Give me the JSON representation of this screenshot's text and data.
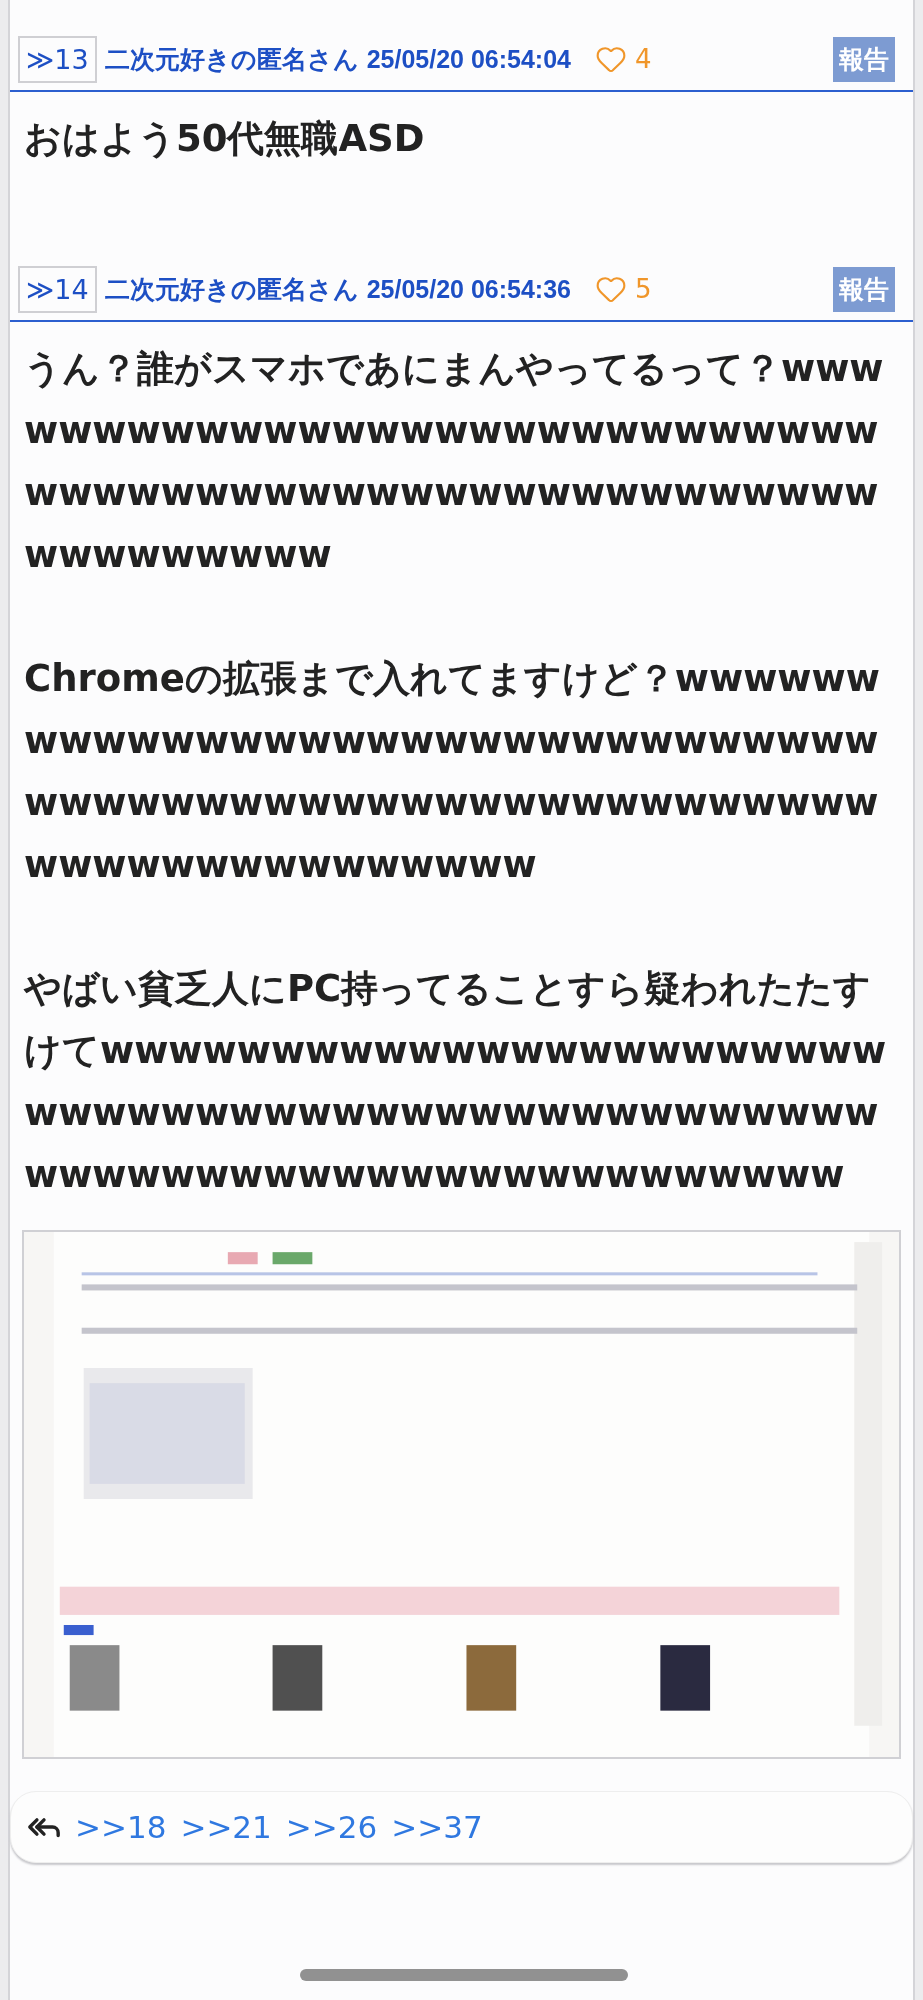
{
  "posts": [
    {
      "number": "≫13",
      "name": "二次元好きの匿名さん",
      "date": "25/05/20 06:54:04",
      "likes": "4",
      "report": "報告",
      "body": [
        "おはよう50代無職ASD"
      ]
    },
    {
      "number": "≫14",
      "name": "二次元好きの匿名さん",
      "date": "25/05/20 06:54:36",
      "likes": "5",
      "report": "報告",
      "body": [
        "うん？誰がスマホであにまんやってるって？wwwwwwwwwwwwwwwwwwwwwwwwwwwwwwwwwwwwwwwwwwwwwwwwwwwwwwwwwwwwww",
        "Chromeの拡張まで入れてますけど？wwwwwwwwwwwwwwwwwwwwwwwwwwwwwwwwwwwwwwwwwwwwwwwwwwwwwwwwwwwwwwwwwwwwwww",
        "やばい貧乏人にPC持ってることすら疑われたたすけてwwwwwwwwwwwwwwwwwwwwwwwwwwwwwwwwwwwwwwwwwwwwwwwwwwwwwwwwwwwwwwwwwwwwwwww"
      ],
      "attachment": {
        "kind": "picture"
      },
      "replies": [
        ">>18",
        ">>21",
        ">>26",
        ">>37"
      ]
    }
  ]
}
